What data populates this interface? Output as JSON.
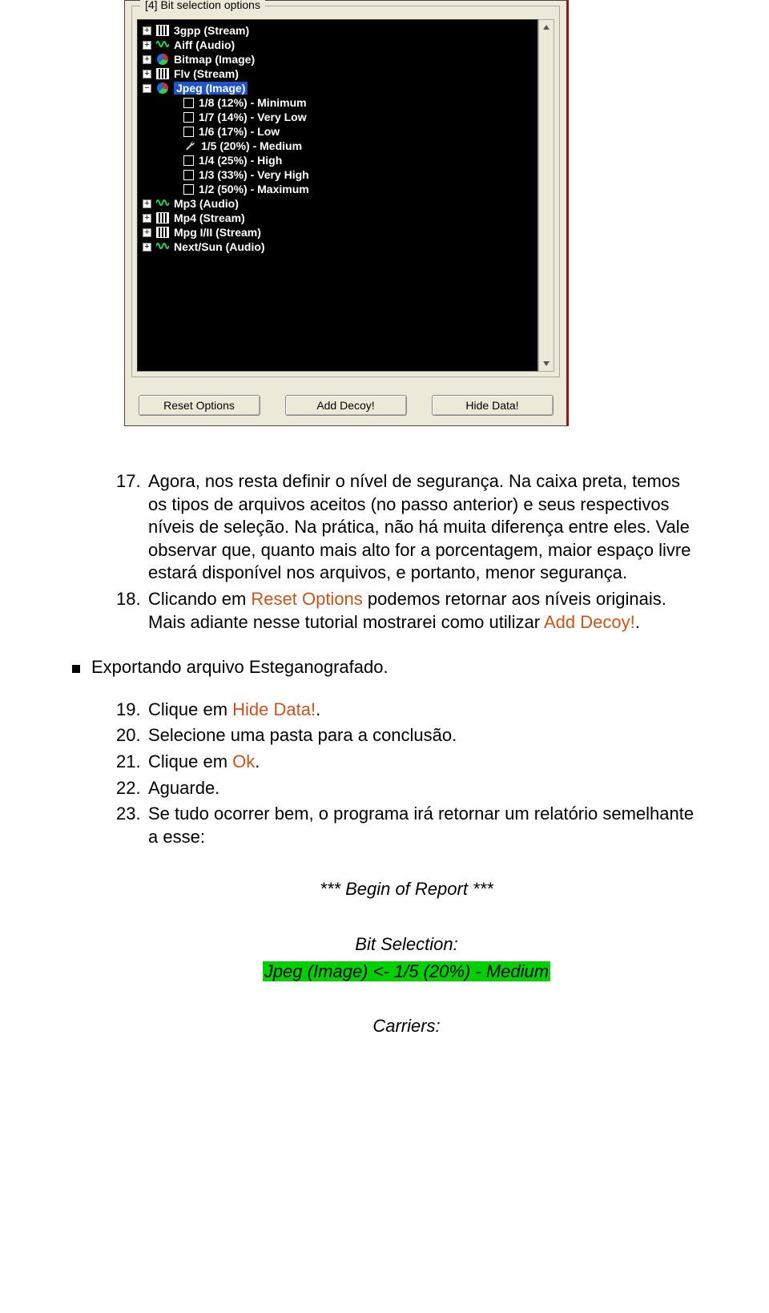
{
  "fieldset_label": "[4]  Bit selection options",
  "tree": {
    "top": [
      {
        "label": "3gpp (Stream)",
        "icon": "stream",
        "exp": "+"
      },
      {
        "label": "Aiff (Audio)",
        "icon": "audio",
        "exp": "+"
      },
      {
        "label": "Bitmap (Image)",
        "icon": "pie",
        "exp": "+"
      },
      {
        "label": "Flv (Stream)",
        "icon": "stream",
        "exp": "+"
      }
    ],
    "jpeg": {
      "label": "Jpeg (Image)",
      "exp": "−"
    },
    "jpeg_children": [
      {
        "label": "1/8 (12%) - Minimum",
        "icon": "chk"
      },
      {
        "label": "1/7 (14%) - Very Low",
        "icon": "chk"
      },
      {
        "label": "1/6 (17%) - Low",
        "icon": "chk"
      },
      {
        "label": "1/5 (20%) - Medium",
        "icon": "wrench"
      },
      {
        "label": "1/4 (25%) - High",
        "icon": "chk"
      },
      {
        "label": "1/3 (33%) - Very High",
        "icon": "chk"
      },
      {
        "label": "1/2 (50%) - Maximum",
        "icon": "chk"
      }
    ],
    "bottom": [
      {
        "label": "Mp3 (Audio)",
        "icon": "audio",
        "exp": "+"
      },
      {
        "label": "Mp4 (Stream)",
        "icon": "stream",
        "exp": "+"
      },
      {
        "label": "Mpg I/II (Stream)",
        "icon": "stream",
        "exp": "+"
      },
      {
        "label": "Next/Sun (Audio)",
        "icon": "audio",
        "exp": "+"
      }
    ]
  },
  "buttons": {
    "reset": "Reset Options",
    "decoy": "Add Decoy!",
    "hide": "Hide Data!"
  },
  "step17": {
    "num": "17.",
    "t1": "Agora, nos resta definir o nível de segurança. Na caixa preta, temos os tipos de arquivos aceitos (no passo anterior) e seus respectivos níveis de seleção. Na prática, não há muita diferença entre eles. Vale observar que, quanto mais alto for a porcentagem, maior espaço livre estará disponível nos arquivos, e portanto, menor segurança."
  },
  "step18": {
    "num": "18.",
    "pre": "Clicando em ",
    "link1": "Reset Options",
    "mid": " podemos retornar aos níveis originais. Mais adiante nesse tutorial mostrarei como utilizar ",
    "link2": "Add Decoy!",
    "post": "."
  },
  "section_title": "Exportando arquivo Esteganografado.",
  "step19": {
    "num": "19.",
    "pre": "Clique em ",
    "link": "Hide Data!",
    "post": "."
  },
  "step20": {
    "num": "20.",
    "text": "Selecione uma pasta para a conclusão."
  },
  "step21": {
    "num": "21.",
    "pre": "Clique em ",
    "link": "Ok",
    "post": "."
  },
  "step22": {
    "num": "22.",
    "text": "Aguarde."
  },
  "step23": {
    "num": "23.",
    "text": "Se tudo ocorrer bem, o programa irá retornar um relatório semelhante a esse:"
  },
  "report": {
    "begin": "*** Begin of Report ***",
    "bit_sel_h": "Bit Selection:",
    "bit_sel_v": "Jpeg (Image) <- 1/5 (20%) - Medium",
    "carriers_h": "Carriers:"
  }
}
